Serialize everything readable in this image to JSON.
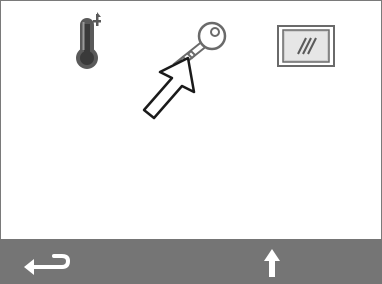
{
  "screen": {
    "icons": [
      {
        "name": "thermometer-icon",
        "role": "temperature settings"
      },
      {
        "name": "key-icon",
        "role": "access / lock settings"
      },
      {
        "name": "display-icon",
        "role": "display settings"
      }
    ],
    "pointer": "hand-pointer-arrow-icon"
  },
  "bottom_bar": {
    "back": "back-arrow-icon",
    "up": "up-arrow-icon"
  },
  "colors": {
    "bar": "#757575",
    "icon_dark": "#4a4a4a",
    "icon_mid": "#7a7a7a",
    "background": "#ffffff"
  }
}
